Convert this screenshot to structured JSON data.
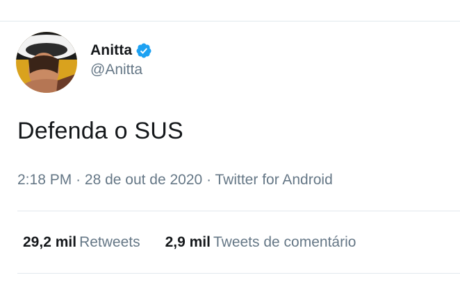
{
  "tweet": {
    "author": {
      "display_name": "Anitta",
      "handle": "@Anitta",
      "verified": true,
      "verified_icon": "verified-badge-icon",
      "avatar": "profile-photo"
    },
    "text": "Defenda o SUS",
    "meta": {
      "time": "2:18 PM",
      "separator": "·",
      "date": "28 de out de 2020",
      "source": "Twitter for Android"
    },
    "stats": {
      "retweets_count": "29,2 mil",
      "retweets_label": "Retweets",
      "quotes_count": "2,9 mil",
      "quotes_label": "Tweets de comentário"
    }
  },
  "colors": {
    "text_primary": "#14171a",
    "text_secondary": "#657786",
    "divider": "#e1e8ed",
    "verified_blue": "#1da1f2"
  }
}
